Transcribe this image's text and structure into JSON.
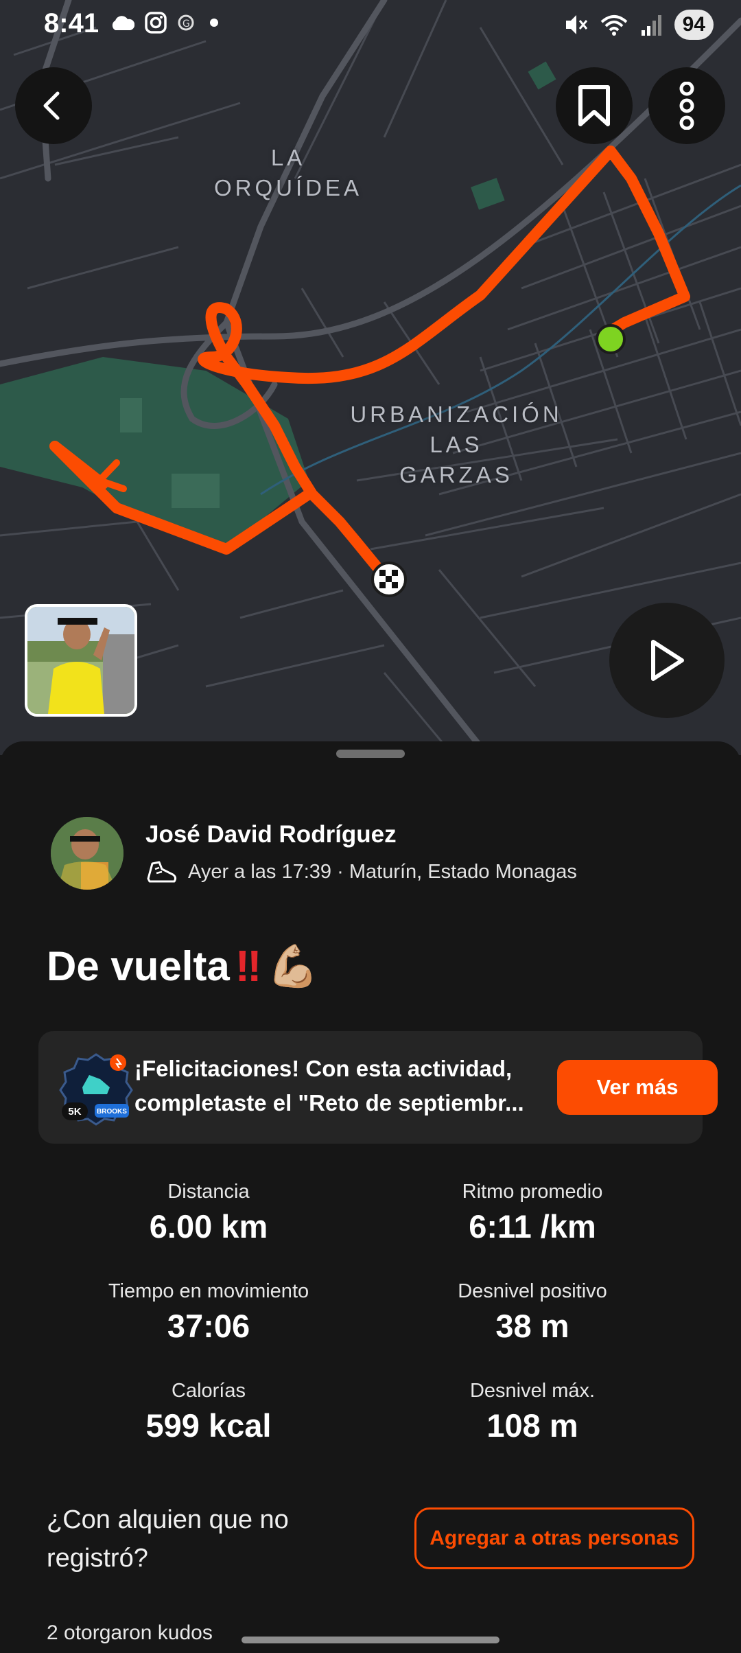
{
  "status_bar": {
    "time": "8:41",
    "battery": "94",
    "left_icons": [
      "cloud-icon",
      "instagram-icon",
      "app-notification-icon",
      "dot-icon"
    ],
    "right_icons": [
      "mute-icon",
      "wifi-icon",
      "signal-icon"
    ]
  },
  "map": {
    "labels": {
      "orquidea": "LA\nORQUÍDEA",
      "urbanizacion": "URBANIZACIÓN\nLAS\nGARZAS"
    },
    "route_color": "#fc4c02",
    "start_marker_color": "#7ed321"
  },
  "toolbar": {
    "back_icon": "chevron-left-icon",
    "bookmark_icon": "bookmark-icon",
    "more_icon": "more-vertical-icon",
    "play_icon": "play-icon"
  },
  "activity": {
    "athlete_name": "José David Rodríguez",
    "meta": "Ayer a las 17:39 · Maturín, Estado Monagas",
    "activity_icon": "running-shoe-icon",
    "title": "De vuelta",
    "title_emojis": [
      "‼",
      "💪🏼"
    ]
  },
  "challenge": {
    "line1": "¡Felicitaciones! Con esta actividad,",
    "line2": "completaste el \"Reto de septiembr...",
    "badge_text": "5K",
    "badge_brand": "BROOKS",
    "button_label": "Ver más"
  },
  "stats": [
    {
      "label": "Distancia",
      "value": "6.00 km"
    },
    {
      "label": "Ritmo promedio",
      "value": "6:11 /km"
    },
    {
      "label": "Tiempo en movimiento",
      "value": "37:06"
    },
    {
      "label": "Desnivel positivo",
      "value": "38 m"
    },
    {
      "label": "Calorías",
      "value": "599 kcal"
    },
    {
      "label": "Desnivel máx.",
      "value": "108 m"
    }
  ],
  "with_someone": {
    "question": "¿Con alquien que no registró?",
    "button_label": "Agregar a otras personas"
  },
  "kudos": "2 otorgaron kudos",
  "colors": {
    "accent": "#fc4c02",
    "background": "#161616",
    "card": "#252525",
    "map": "#2b2d33"
  }
}
